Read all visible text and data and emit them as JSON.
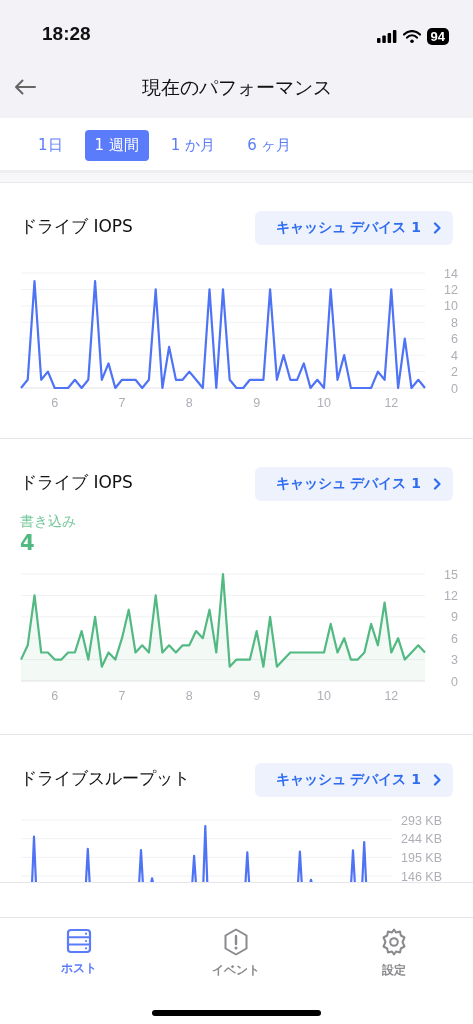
{
  "status_bar": {
    "time": "18:28",
    "battery": "94"
  },
  "nav": {
    "title": "現在のパフォーマンス"
  },
  "tabs": [
    {
      "label": "1日",
      "selected": false
    },
    {
      "label": "1 週間",
      "selected": true
    },
    {
      "label": "1 か月",
      "selected": false
    },
    {
      "label": "6 ヶ月",
      "selected": false
    }
  ],
  "sections": [
    {
      "title": "ドライブ IOPS",
      "button": "キャッシュ デバイス 1",
      "chart_data": {
        "type": "line",
        "categories": [
          null,
          null,
          null,
          null,
          null,
          "6",
          null,
          null,
          null,
          null,
          null,
          null,
          null,
          null,
          null,
          "7",
          null,
          null,
          null,
          null,
          null,
          null,
          null,
          null,
          null,
          "8",
          null,
          null,
          null,
          null,
          null,
          null,
          null,
          null,
          null,
          "9",
          null,
          null,
          null,
          null,
          null,
          null,
          null,
          null,
          null,
          "10",
          null,
          null,
          null,
          null,
          null,
          null,
          null,
          null,
          null,
          "12",
          null,
          null,
          null,
          null,
          null
        ],
        "grid": true,
        "ylim": [
          0,
          14
        ],
        "yticks": [
          0,
          2,
          4,
          6,
          8,
          10,
          12,
          14
        ],
        "series": [
          {
            "color": "#4f73f5",
            "values": [
              0,
              1,
              13,
              1,
              2,
              0,
              0,
              0,
              1,
              0,
              1,
              13,
              1,
              3,
              0,
              1,
              1,
              1,
              0,
              1,
              12,
              0,
              5,
              1,
              1,
              2,
              1,
              0,
              12,
              0,
              12,
              1,
              0,
              0,
              1,
              1,
              1,
              12,
              1,
              4,
              1,
              1,
              3,
              0,
              1,
              0,
              12,
              1,
              4,
              0,
              0,
              0,
              0,
              2,
              1,
              12,
              0,
              6,
              0,
              1,
              0
            ]
          }
        ]
      }
    },
    {
      "title": "ドライブ IOPS",
      "button": "キャッシュ デバイス 1",
      "legend": {
        "value": "4"
      },
      "chart_data": {
        "type": "area",
        "categories": [
          null,
          null,
          null,
          null,
          null,
          "6",
          null,
          null,
          null,
          null,
          null,
          null,
          null,
          null,
          null,
          "7",
          null,
          null,
          null,
          null,
          null,
          null,
          null,
          null,
          null,
          "8",
          null,
          null,
          null,
          null,
          null,
          null,
          null,
          null,
          null,
          "9",
          null,
          null,
          null,
          null,
          null,
          null,
          null,
          null,
          null,
          "10",
          null,
          null,
          null,
          null,
          null,
          null,
          null,
          null,
          null,
          "12",
          null,
          null,
          null,
          null,
          null
        ],
        "grid": true,
        "ylim": [
          0,
          15
        ],
        "yticks": [
          0,
          3,
          6,
          9,
          12,
          15
        ],
        "series": [
          {
            "name": "書き込み",
            "color": "#52b982",
            "values": [
              3,
              5,
              12,
              4,
              4,
              3,
              3,
              4,
              4,
              7,
              3,
              9,
              2,
              4,
              3,
              6,
              10,
              4,
              5,
              4,
              12,
              4,
              5,
              4,
              5,
              5,
              7,
              6,
              10,
              4,
              15,
              2,
              3,
              3,
              3,
              7,
              2,
              9,
              2,
              3,
              4,
              4,
              4,
              4,
              4,
              4,
              8,
              4,
              6,
              3,
              3,
              4,
              8,
              5,
              11,
              4,
              6,
              3,
              4,
              5,
              4
            ]
          }
        ]
      }
    },
    {
      "title": "ドライブスループット",
      "button": "キャッシュ デバイス 1",
      "axis_labels": [
        "293 KB",
        "244 KB",
        "195 KB",
        "146 KB"
      ]
    }
  ],
  "tab_bar": [
    {
      "label": "ホスト",
      "kind": "host",
      "selected": true
    },
    {
      "label": "イベント",
      "kind": "event",
      "selected": false
    },
    {
      "label": "設定",
      "kind": "settings",
      "selected": false
    }
  ]
}
